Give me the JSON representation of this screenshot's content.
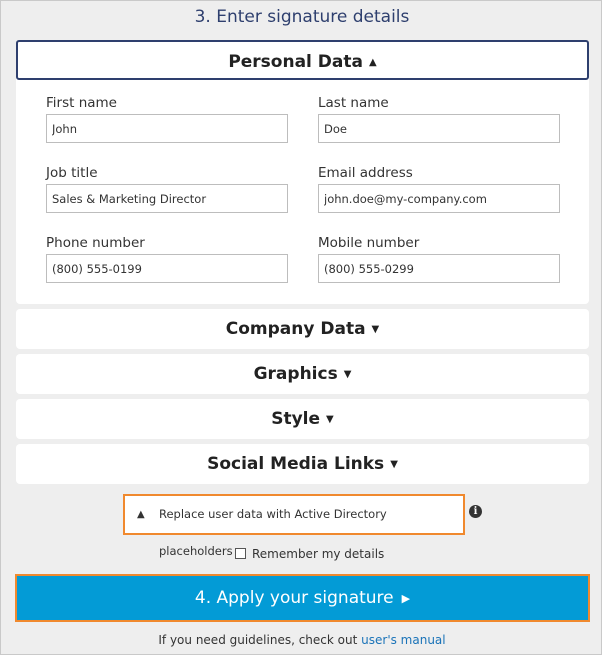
{
  "step3_title": "3. Enter signature details",
  "personal": {
    "header": "Personal Data",
    "fields": [
      {
        "label": "First name",
        "value": "John"
      },
      {
        "label": "Last name",
        "value": "Doe"
      },
      {
        "label": "Job title",
        "value": "Sales & Marketing Director"
      },
      {
        "label": "Email address",
        "value": "john.doe@my-company.com"
      },
      {
        "label": "Phone number",
        "value": "(800) 555-0199"
      },
      {
        "label": "Mobile number",
        "value": "(800) 555-0299"
      }
    ]
  },
  "sections": [
    "Company Data",
    "Graphics",
    "Style",
    "Social Media Links"
  ],
  "ad_placeholder": {
    "label": "Replace user data with Active Directory placeholders",
    "icon": "info-icon"
  },
  "remember": {
    "label": "Remember my details",
    "checked": false
  },
  "apply_button": "4. Apply your signature",
  "footer": {
    "text": "If you need guidelines, check out",
    "link": "user's manual"
  },
  "colors": {
    "accent": "#039bd6",
    "highlight_border": "#f0892e",
    "title": "#2e3f6e"
  }
}
